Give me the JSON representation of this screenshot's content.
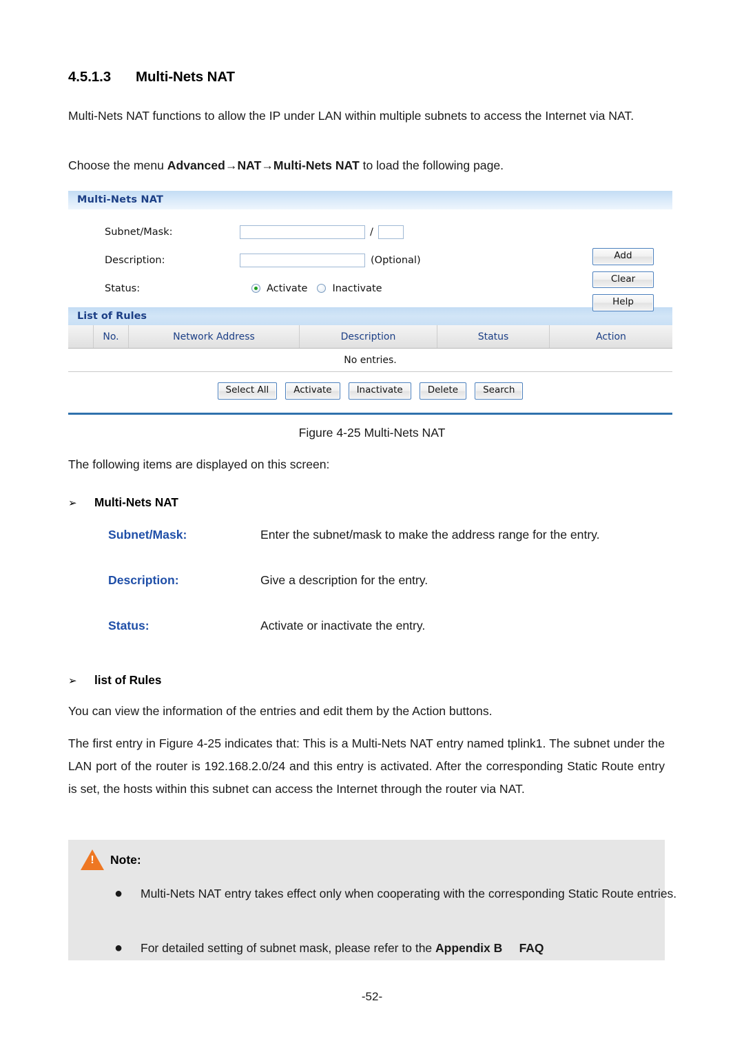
{
  "section": {
    "number": "4.5.1.3",
    "title": "Multi-Nets NAT"
  },
  "intro": {
    "p1": "Multi-Nets NAT functions to allow the IP under LAN within multiple subnets to access the Internet via NAT.",
    "p2_prefix": "Choose the menu ",
    "p2_menu1": "Advanced",
    "p2_arrow1": "→",
    "p2_menu2": "NAT",
    "p2_arrow2": "→",
    "p2_menu3": "Multi-Nets NAT",
    "p2_suffix": " to load the following page."
  },
  "panel": {
    "header_title": "Multi-Nets NAT",
    "fields": {
      "subnet_label": "Subnet/Mask:",
      "subnet_value": "",
      "subnet_placeholder": "",
      "mask_value": "",
      "separator": "/",
      "description_label": "Description:",
      "description_value": "",
      "description_hint": "(Optional)",
      "status_label": "Status:",
      "status_options": [
        {
          "label": "Activate",
          "selected": true
        },
        {
          "label": "Inactivate",
          "selected": false
        }
      ]
    },
    "side_buttons": [
      {
        "label": "Add"
      },
      {
        "label": "Clear"
      },
      {
        "label": "Help"
      }
    ]
  },
  "rules": {
    "header_title": "List of Rules",
    "columns": [
      "",
      "No.",
      "Network Address",
      "Description",
      "Status",
      "Action"
    ],
    "rows": [],
    "empty_text": "No entries.",
    "action_buttons": [
      {
        "label": "Select All"
      },
      {
        "label": "Activate"
      },
      {
        "label": "Inactivate"
      },
      {
        "label": "Delete"
      },
      {
        "label": "Search"
      }
    ]
  },
  "figure": {
    "caption": "Figure 4-25 Multi-Nets NAT"
  },
  "body": {
    "items_intro": "The following items are displayed on this screen:",
    "group1_arrow": "➢",
    "group1_title": "Multi-Nets NAT",
    "definitions": [
      {
        "term": "Subnet/Mask:",
        "desc": "Enter the subnet/mask to make the address range for the entry."
      },
      {
        "term": "Description:",
        "desc": "Give a description for the entry."
      },
      {
        "term": "Status:",
        "desc": "Activate or inactivate the entry."
      }
    ],
    "group2_arrow": "➢",
    "group2_title": "list of Rules",
    "p3": "You can view the information of the entries and edit them by the Action buttons.",
    "p4": "The first entry in Figure 4-25 indicates that: This is a Multi-Nets NAT entry named tplink1. The subnet under the LAN port of the router is 192.168.2.0/24 and this entry is activated. After the corresponding Static Route entry is set, the hosts within this subnet can access the Internet through the router via NAT."
  },
  "note": {
    "title": "Note:",
    "bullet_glyph": "●",
    "item1": "Multi-Nets NAT entry takes effect only when cooperating with the corresponding Static Route entries.",
    "item2_prefix": "For detailed setting of subnet mask, please refer to the ",
    "item2_bold1": "Appendix B",
    "item2_bold2": "FAQ"
  },
  "footer": {
    "page_number": "-52-"
  },
  "colors": {
    "panel_header_text": "#1c3f86",
    "panel_header_bg": "#c3dcf4",
    "panel_bottom_border": "#3072ad",
    "button_border": "#4a7ebb",
    "definition_term": "#1f4fa8",
    "radio_selected": "#1e9e1e",
    "note_bg": "#e6e6e6",
    "warn_icon": "#ee7722"
  }
}
